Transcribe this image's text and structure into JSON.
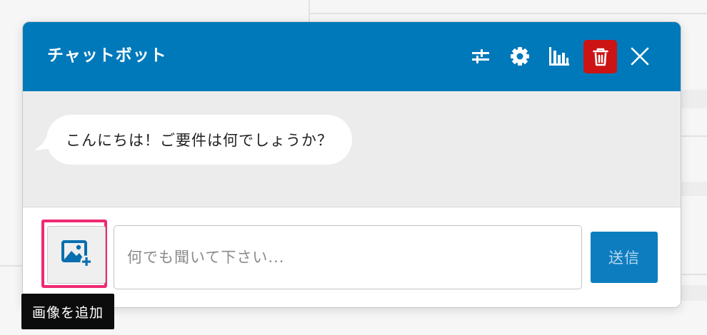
{
  "chat": {
    "title": "チャットボット",
    "header_icons": [
      "sliders-icon",
      "gear-icon",
      "bar-chart-icon",
      "trash-icon",
      "close-icon"
    ],
    "colors": {
      "header": "#0079ba",
      "delete_button": "#cc1414",
      "highlight_border": "#ee2a73",
      "send_button": "#0d7dc0",
      "messages_background": "#ececec"
    },
    "messages": [
      {
        "from": "bot",
        "text": "こんにちは！ご要件は何でしょうか？"
      }
    ],
    "input": {
      "value": "",
      "placeholder": "何でも聞いて下さい..."
    },
    "image_button": {
      "icon": "image-add-icon"
    },
    "send_label": "送信",
    "tooltip": "画像を追加"
  }
}
